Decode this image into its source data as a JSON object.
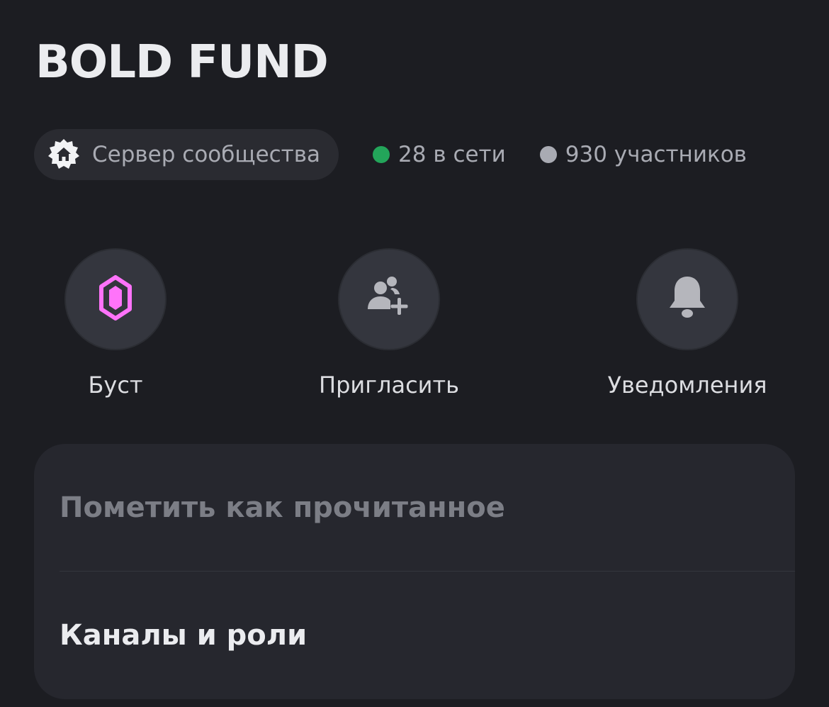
{
  "server": {
    "name": "BOLD FUND",
    "badge": {
      "icon": "community-home-icon",
      "label": "Сервер сообщества"
    },
    "online": {
      "text": "28 в сети",
      "dot_color": "#23a55a"
    },
    "members": {
      "text": "930 участников",
      "dot_color": "#a9abb3"
    }
  },
  "actions": [
    {
      "label": "Буст",
      "icon": "boost-gem-icon",
      "icon_color": "#ff73fa"
    },
    {
      "label": "Пригласить",
      "icon": "invite-people-icon",
      "icon_color": "#b5b6bc"
    },
    {
      "label": "Уведомления",
      "icon": "bell-icon",
      "icon_color": "#b5b6bc"
    }
  ],
  "menu": {
    "mark_read": "Пометить как прочитанное",
    "channels_roles": "Каналы и роли"
  }
}
